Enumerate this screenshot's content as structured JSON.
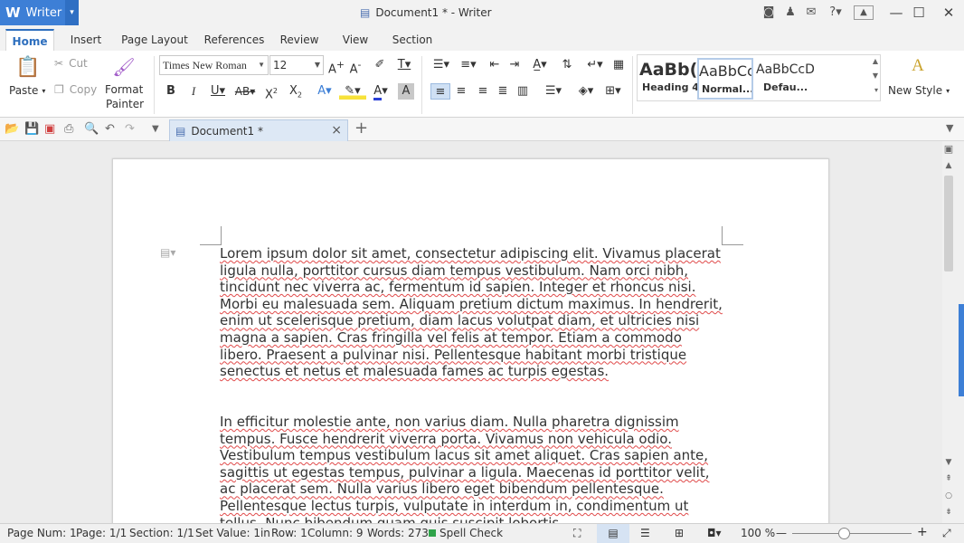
{
  "app": {
    "logo": "W",
    "name": "Writer",
    "menu_arrow": "▾"
  },
  "window": {
    "title": "Document1 * - Writer",
    "minimize": "—",
    "maximize": "☐",
    "close": "✕"
  },
  "title_icons": [
    "skin-icon",
    "shirt-icon",
    "chat-icon",
    "help-icon"
  ],
  "help_label": "?",
  "tabs": [
    {
      "label": "Home",
      "active": true
    },
    {
      "label": "Insert"
    },
    {
      "label": "Page Layout"
    },
    {
      "label": "References"
    },
    {
      "label": "Review"
    },
    {
      "label": "View"
    },
    {
      "label": "Section"
    }
  ],
  "ribbon": {
    "paste": "Paste",
    "cut": "Cut",
    "copy": "Copy",
    "format_painter_1": "Format",
    "format_painter_2": "Painter",
    "font_name": "Times New Roman",
    "font_size": "12",
    "styles": [
      {
        "preview": "AaBb(",
        "label": "Heading 4"
      },
      {
        "preview": "AaBbCc",
        "label": "Normal..."
      },
      {
        "preview": "AaBbCcD",
        "label": "Defau..."
      }
    ],
    "new_style": "New Style"
  },
  "doc_tab": {
    "label": "Document1 *",
    "close": "×",
    "add": "+"
  },
  "document": {
    "paragraphs": [
      "Lorem ipsum dolor sit amet, consectetur adipiscing elit. Vivamus placerat ligula nulla, porttitor cursus diam tempus vestibulum. Nam orci nibh, tincidunt nec viverra ac, fermentum id sapien. Integer et rhoncus nisi. Morbi eu malesuada sem. Aliquam pretium dictum maximus. In hendrerit, enim ut scelerisque pretium, diam lacus volutpat diam, et ultricies nisi magna a sapien. Cras fringilla vel felis at tempor. Etiam a commodo libero. Praesent a pulvinar nisi. Pellentesque habitant morbi tristique senectus et netus et malesuada fames ac turpis egestas.",
      "In efficitur molestie ante, non varius diam. Nulla pharetra dignissim tempus. Fusce hendrerit viverra porta. Vivamus non vehicula odio. Vestibulum tempus vestibulum lacus sit amet aliquet. Cras sapien ante, sagittis ut egestas tempus, pulvinar a ligula. Maecenas id porttitor velit, ac placerat sem. Nulla varius libero eget bibendum pellentesque. Pellentesque lectus turpis, vulputate in interdum in, condimentum ut tellus. Nunc bibendum quam quis suscipit lobortis."
    ]
  },
  "status": {
    "page_num": "Page Num: 1",
    "page": "Page: 1/1",
    "section": "Section: 1/1",
    "set_value": "Set Value: 1in",
    "row": "Row: 1",
    "column": "Column: 9",
    "words": "Words: 273",
    "spell": "Spell Check",
    "zoom": "100 %",
    "zoom_level": 1.0
  },
  "colors": {
    "accent": "#3d7fd6",
    "spell_ok": "#2fa34a",
    "squiggle": "#e04a4a"
  }
}
